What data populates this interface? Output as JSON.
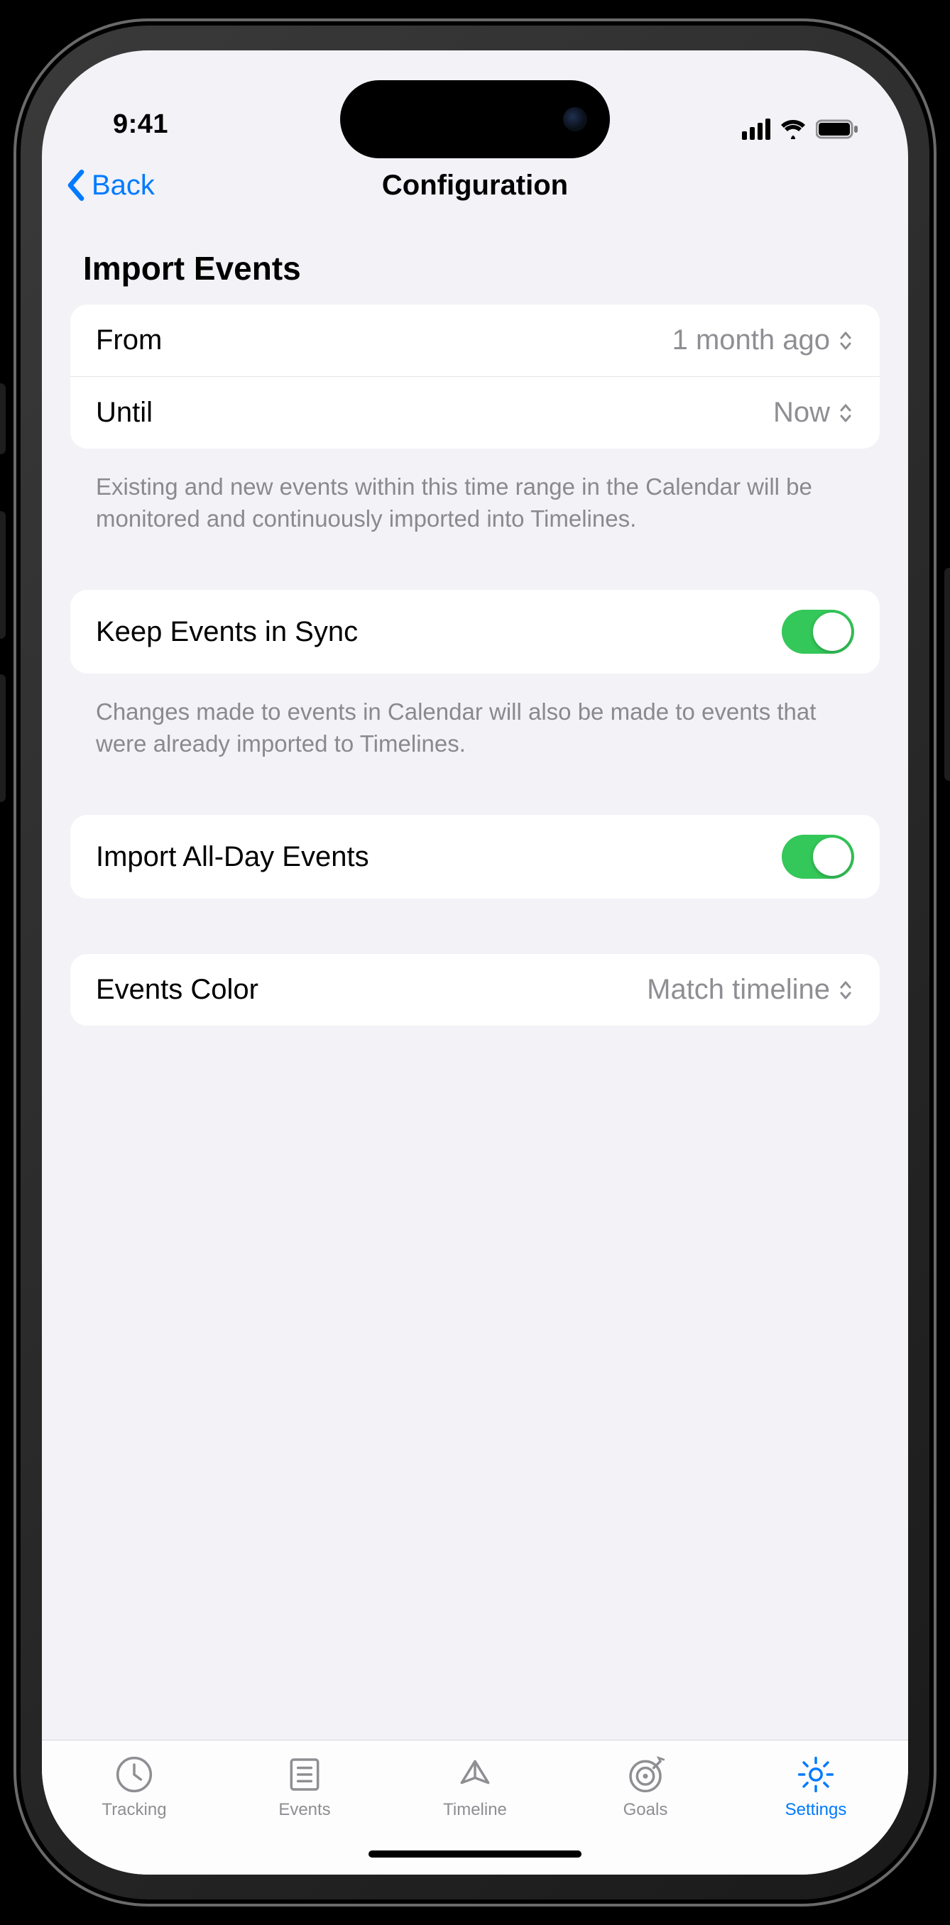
{
  "status": {
    "time": "9:41"
  },
  "nav": {
    "back": "Back",
    "title": "Configuration"
  },
  "section": {
    "title": "Import Events"
  },
  "range": {
    "from_label": "From",
    "from_value": "1 month ago",
    "until_label": "Until",
    "until_value": "Now",
    "footer": "Existing and new events within this time range in the Calendar will be monitored and continuously imported into Timelines."
  },
  "sync": {
    "label": "Keep Events in Sync",
    "on": true,
    "footer": "Changes made to events in Calendar will also be made to events that were already imported to Timelines."
  },
  "allday": {
    "label": "Import All-Day Events",
    "on": true
  },
  "color": {
    "label": "Events Color",
    "value": "Match timeline"
  },
  "tabs": {
    "tracking": "Tracking",
    "events": "Events",
    "timeline": "Timeline",
    "goals": "Goals",
    "settings": "Settings"
  }
}
